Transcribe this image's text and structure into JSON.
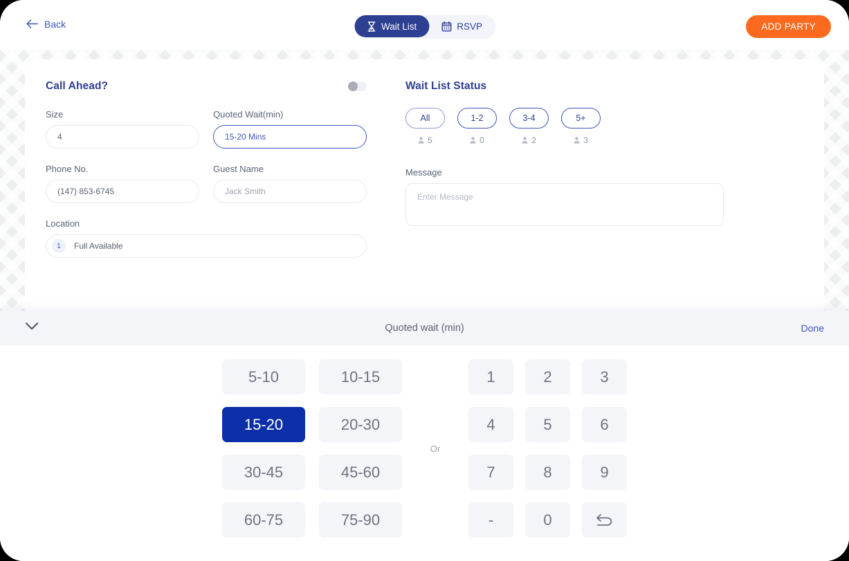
{
  "header": {
    "back_label": "Back",
    "back_icon": "arrow-left-icon",
    "tabs": [
      {
        "label": "Wait List",
        "icon": "hourglass-icon",
        "active": true
      },
      {
        "label": "RSVP",
        "icon": "calendar-icon",
        "active": false
      }
    ],
    "add_party_label": "ADD PARTY",
    "accent_orange": "#fb6a1e",
    "accent_blue": "#2c3f91"
  },
  "call_ahead": {
    "title": "Call Ahead?",
    "toggle_on": false,
    "fields": {
      "size_label": "Size",
      "size_value": "4",
      "quoted_wait_label": "Quoted Wait(min)",
      "quoted_wait_value": "15-20 Mins",
      "phone_label": "Phone No.",
      "phone_value": "(147) 853-6745",
      "guest_label": "Guest Name",
      "guest_value": "Jack Smith",
      "location_label": "Location",
      "location_badge": "1",
      "location_value": "Full Available"
    }
  },
  "wait_list_status": {
    "title": "Wait List Status",
    "filters": [
      {
        "label": "All",
        "count": "5",
        "active": true
      },
      {
        "label": "1-2",
        "count": "0",
        "active": false
      },
      {
        "label": "3-4",
        "count": "2",
        "active": false
      },
      {
        "label": "5+",
        "count": "3",
        "active": false
      }
    ],
    "message_label": "Message",
    "message_placeholder": "Enter Message"
  },
  "picker": {
    "title": "Quoted wait (min)",
    "done_label": "Done",
    "collapse_icon": "chevron-down-icon",
    "or_label": "Or",
    "selected_range": "15-20",
    "ranges": [
      "5-10",
      "10-15",
      "15-20",
      "20-30",
      "30-45",
      "45-60",
      "60-75",
      "75-90"
    ],
    "digits": [
      "1",
      "2",
      "3",
      "4",
      "5",
      "6",
      "7",
      "8",
      "9",
      "-",
      "0"
    ],
    "backspace_icon": "undo-arrow-icon",
    "selected_color": "#0b2fa8"
  }
}
